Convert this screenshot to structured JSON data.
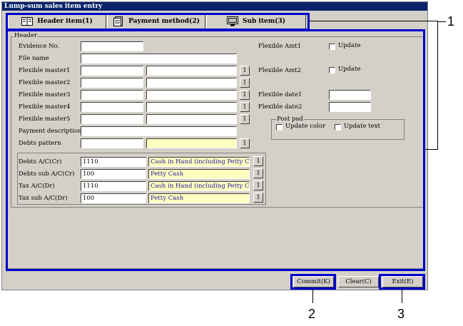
{
  "window": {
    "title": "Lump-sum sales item entry"
  },
  "tabs": [
    {
      "label": "Header item(1)",
      "icon": "book-icon"
    },
    {
      "label": "Payment method(2)",
      "icon": "document-icon"
    },
    {
      "label": "Sub item(3)",
      "icon": "monitor-icon"
    }
  ],
  "header_group": {
    "legend": "Header"
  },
  "fields": {
    "evidence_no": {
      "label": "Evidence No.",
      "value": ""
    },
    "file_name": {
      "label": "File name",
      "value": ""
    },
    "flexible_masters": [
      {
        "label": "Flexible master1",
        "code": "",
        "name": ""
      },
      {
        "label": "Flexible master2",
        "code": "",
        "name": ""
      },
      {
        "label": "Flexible master3",
        "code": "",
        "name": ""
      },
      {
        "label": "Flexible master4",
        "code": "",
        "name": ""
      },
      {
        "label": "Flexible master5",
        "code": "",
        "name": ""
      }
    ],
    "payment_description": {
      "label": "Payment description",
      "value": ""
    },
    "debts_pattern": {
      "label": "Debts pattern",
      "code": "",
      "name": ""
    }
  },
  "lookup_button_label": "1",
  "right_fields": {
    "flexible_amt1": {
      "label": "Flexible Amt1",
      "update_label": "Update",
      "checked": false
    },
    "flexible_amt2": {
      "label": "Flexible Amt2",
      "update_label": "Update",
      "checked": false
    },
    "flexible_date1": {
      "label": "Flexible date1",
      "value": ""
    },
    "flexible_date2": {
      "label": "Flexible date2",
      "value": ""
    }
  },
  "post_pad": {
    "legend": "Post pad",
    "update_color": {
      "label": "Update color",
      "checked": false
    },
    "update_text": {
      "label": "Update text",
      "checked": false
    }
  },
  "accounts": [
    {
      "label": "Debts A/C(Cr)",
      "code": "1110",
      "name": "Cash in Hand (including Petty Cash)"
    },
    {
      "label": "Debts sub A/C(Cr)",
      "code": "100",
      "name": "Petty Cash"
    },
    {
      "label": "Tax A/C(Dr)",
      "code": "1110",
      "name": "Cash in Hand (including Petty Cash)"
    },
    {
      "label": "Tax sub A/C(Dr)",
      "code": "100",
      "name": "Petty Cash"
    }
  ],
  "buttons": {
    "commit": "Commit(K)",
    "clear": "Clear(C)",
    "exit": "Exit(E)"
  },
  "callouts": {
    "one": "1",
    "two": "2",
    "three": "3"
  },
  "colors": {
    "title_bar": "#0a246a",
    "callout": "#0000cc",
    "lookup_field": "#ffffc0"
  }
}
